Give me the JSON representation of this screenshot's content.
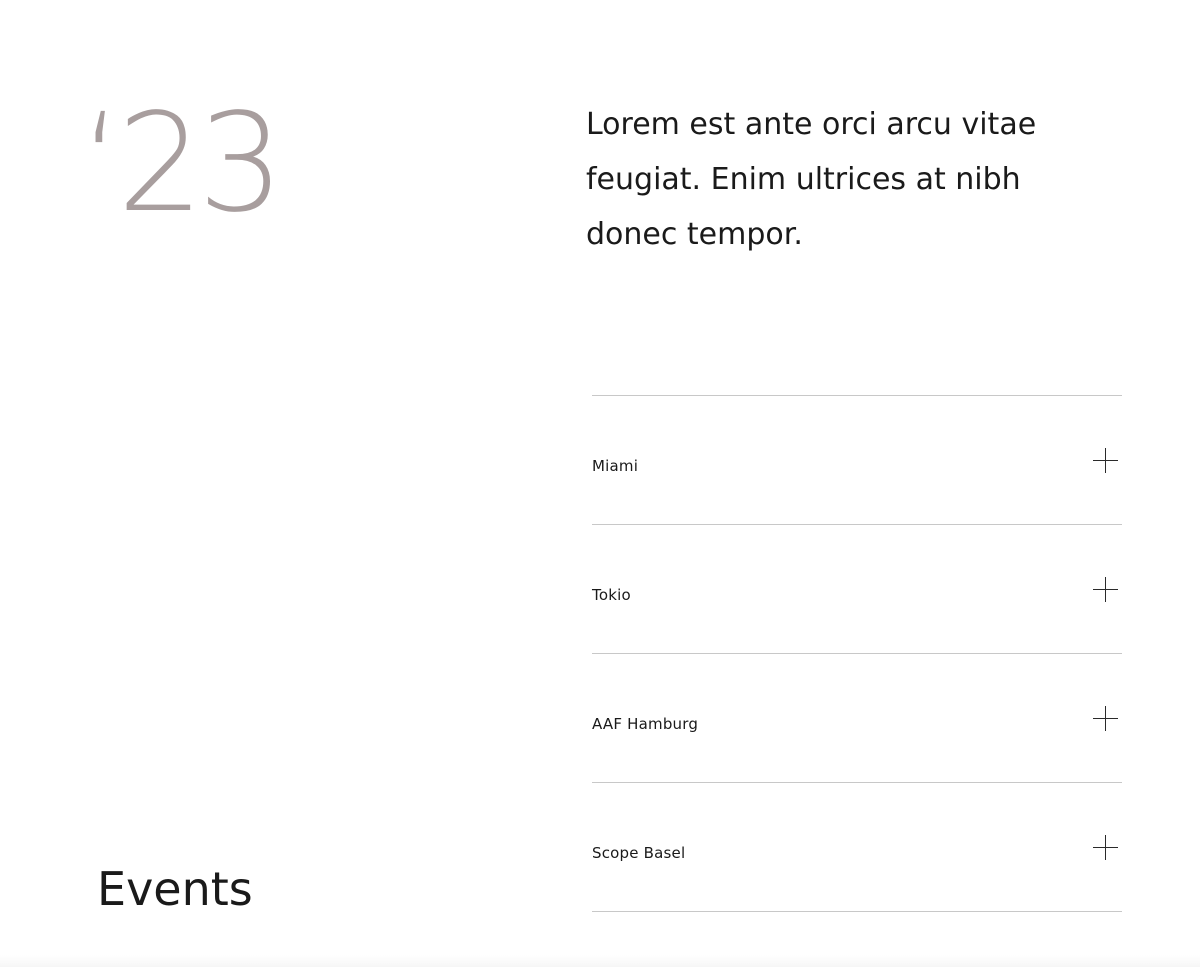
{
  "hero": {
    "year": "‘23",
    "intro": "Lorem est ante orci arcu vitae feugiat. Enim ultrices at nibh donec tempor."
  },
  "section": {
    "title": "Events"
  },
  "accordion": {
    "items": [
      {
        "label": "Miami",
        "icon": "plus-icon"
      },
      {
        "label": "Tokio",
        "icon": "plus-icon"
      },
      {
        "label": "AAF Hamburg",
        "icon": "plus-icon"
      },
      {
        "label": "Scope Basel",
        "icon": "plus-icon"
      }
    ]
  },
  "colors": {
    "background": "#ffffff",
    "text": "#1a1a1a",
    "year_accent": "#a89e9e",
    "divider": "#c8c8c8"
  }
}
